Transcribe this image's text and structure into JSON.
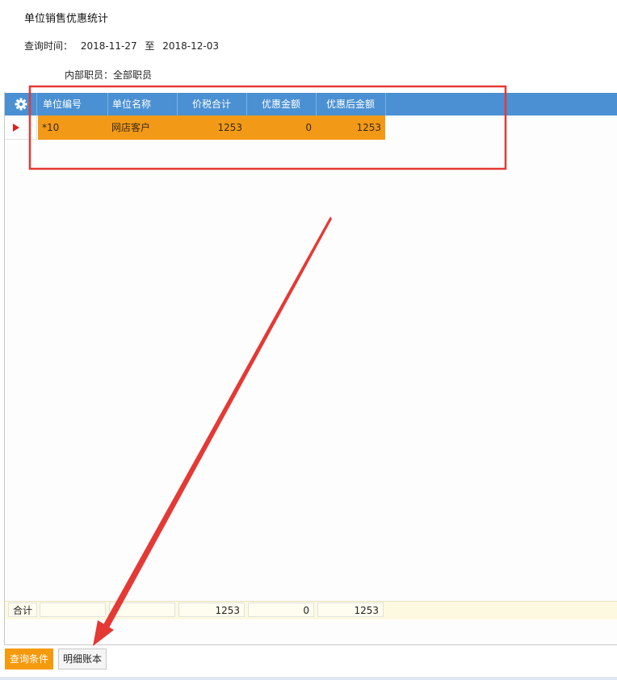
{
  "page": {
    "title": "单位销售优惠统计"
  },
  "query": {
    "label": "查询时间：",
    "start": "2018-11-27",
    "to": "至",
    "end": "2018-12-03"
  },
  "staff": {
    "text": "内部职员：全部职员"
  },
  "grid": {
    "columns": [
      "单位编号",
      "单位名称",
      "价税合计",
      "优惠金额",
      "优惠后金额"
    ],
    "rows": [
      {
        "code": "*10",
        "name": "网店客户",
        "total": "1253",
        "discount": "0",
        "after": "1253"
      }
    ],
    "footer": {
      "label": "合计",
      "total": "1253",
      "discount": "0",
      "after": "1253"
    }
  },
  "buttons": {
    "query": "查询条件",
    "detail": "明细账本"
  },
  "colors": {
    "header": "#4a90d2",
    "selected_row": "#f29a17",
    "annotation": "#e53935",
    "primary_button": "#f59a0c"
  }
}
